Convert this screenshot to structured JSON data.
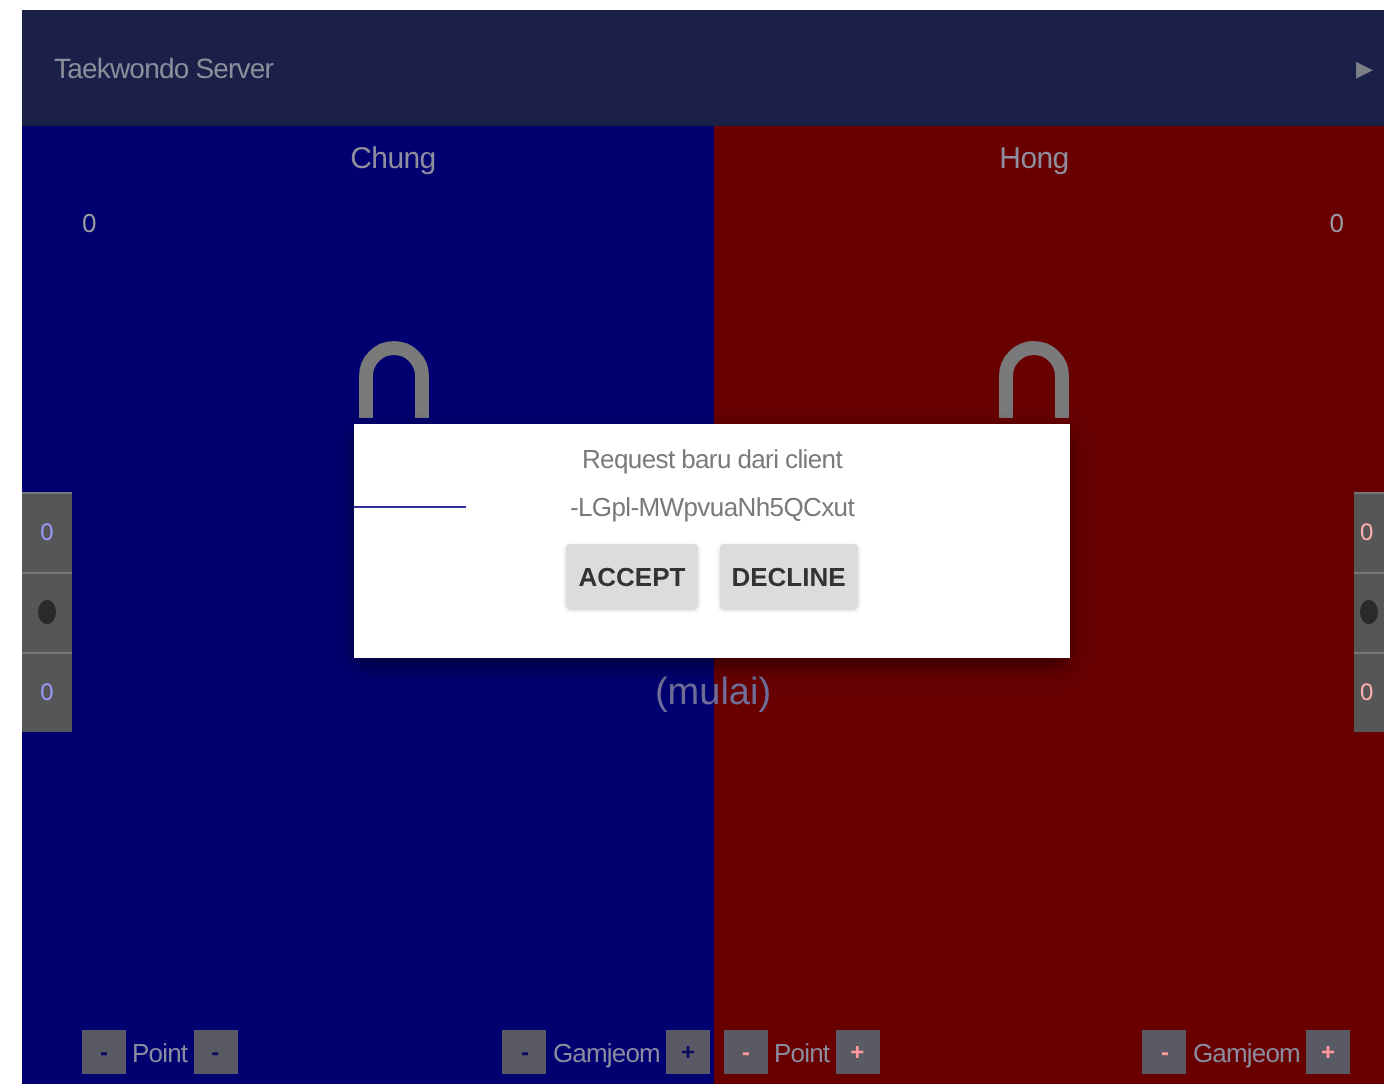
{
  "app_bar": {
    "title": "Taekwondo Server",
    "action": "▶"
  },
  "players": [
    {
      "kind": "blue",
      "name": "Chung",
      "score": "0",
      "side_tabs": [
        {
          "kind": "text",
          "label": "0"
        },
        {
          "kind": "icon"
        },
        {
          "kind": "text",
          "label": "0"
        }
      ],
      "controls": [
        {
          "minus": "-",
          "label": "Point",
          "plus": "-"
        },
        {
          "minus": "-",
          "label": "Gamjeom",
          "plus": "+"
        }
      ]
    },
    {
      "kind": "red",
      "name": "Hong",
      "score": "0",
      "side_tabs": [
        {
          "kind": "text",
          "label": "0"
        },
        {
          "kind": "icon"
        },
        {
          "kind": "text",
          "label": "0"
        }
      ],
      "controls": [
        {
          "minus": "-",
          "label": "Point",
          "plus": "+"
        },
        {
          "minus": "-",
          "label": "Gamjeom",
          "plus": "+"
        }
      ]
    }
  ],
  "status": "(mulai)",
  "dialog": {
    "message": "Request baru dari client",
    "client_id": "-LGpl-MWpvuaNh5QCxut",
    "buttons": [
      "ACCEPT",
      "DECLINE"
    ]
  }
}
